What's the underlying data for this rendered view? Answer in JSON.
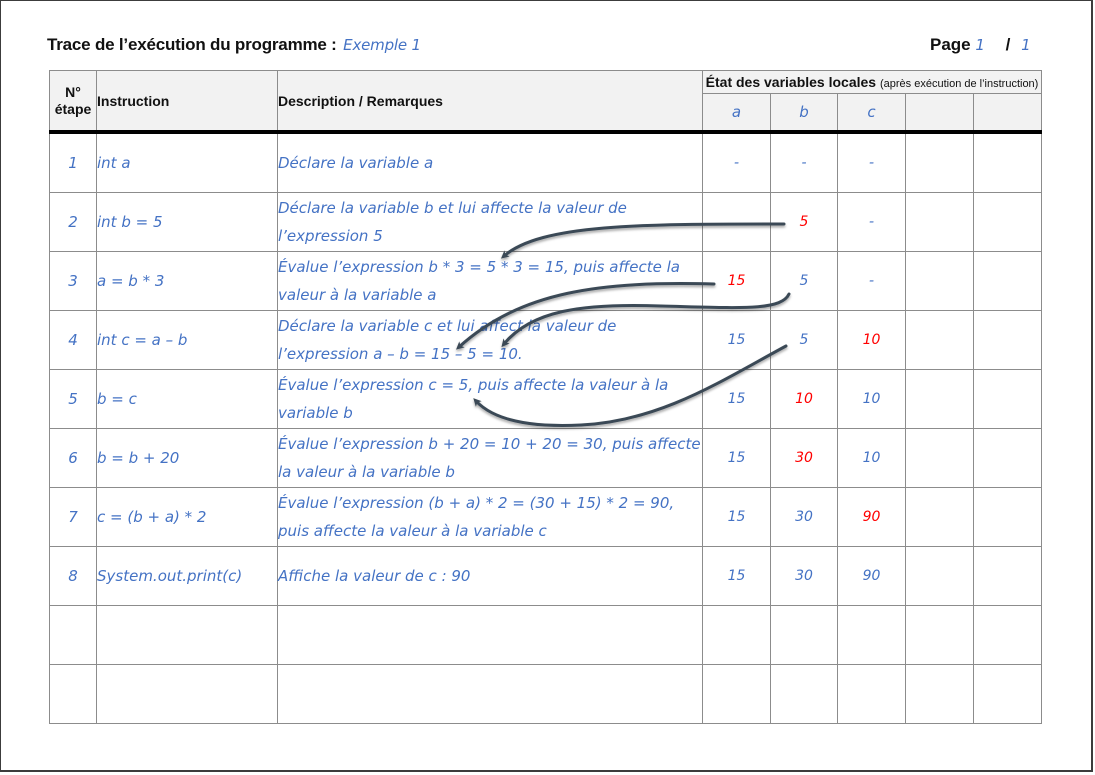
{
  "header": {
    "title": "Trace de l’exécution du programme :",
    "program_name": "Exemple 1",
    "page_label": "Page",
    "page_current": "1",
    "page_separator": "/",
    "page_total": "1"
  },
  "table": {
    "col_step": "N° étape",
    "col_step_line1": "N°",
    "col_step_line2": "étape",
    "col_instruction": "Instruction",
    "col_description": "Description / Remarques",
    "state_title": "État des variables locales",
    "state_subtitle": "(après exécution de l’instruction)",
    "variables": [
      "a",
      "b",
      "c",
      "",
      ""
    ],
    "rows": [
      {
        "step": "1",
        "instruction": "int a",
        "description": "Déclare la variable a",
        "values": [
          "-",
          "-",
          "-",
          "",
          ""
        ],
        "changed": [
          false,
          false,
          false,
          false,
          false
        ]
      },
      {
        "step": "2",
        "instruction": "int b = 5",
        "description": "Déclare la variable b et lui affecte la valeur de l’expression 5",
        "values": [
          "",
          "5",
          "-",
          "",
          ""
        ],
        "changed": [
          false,
          true,
          false,
          false,
          false
        ]
      },
      {
        "step": "3",
        "instruction": "a = b * 3",
        "description": "Évalue l’expression b * 3 = 5 * 3 = 15, puis affecte la valeur à la variable a",
        "values": [
          "15",
          "5",
          "-",
          "",
          ""
        ],
        "changed": [
          true,
          false,
          false,
          false,
          false
        ]
      },
      {
        "step": "4",
        "instruction": "int c = a – b",
        "description": "Déclare la variable c et lui affect la valeur de l’expression a – b = 15 – 5 = 10.",
        "values": [
          "15",
          "5",
          "10",
          "",
          ""
        ],
        "changed": [
          false,
          false,
          true,
          false,
          false
        ]
      },
      {
        "step": "5",
        "instruction": "b = c",
        "description": "Évalue l’expression c = 5, puis affecte la valeur à la variable b",
        "values": [
          "15",
          "10",
          "10",
          "",
          ""
        ],
        "changed": [
          false,
          true,
          false,
          false,
          false
        ]
      },
      {
        "step": "6",
        "instruction": "b = b + 20",
        "description": "Évalue l’expression b + 20 = 10 + 20 = 30, puis affecte la valeur à la variable b",
        "values": [
          "15",
          "30",
          "10",
          "",
          ""
        ],
        "changed": [
          false,
          true,
          false,
          false,
          false
        ]
      },
      {
        "step": "7",
        "instruction": "c = (b + a) * 2",
        "description": "Évalue l’expression (b + a) * 2 = (30 + 15) * 2 = 90, puis affecte la valeur à la variable c",
        "values": [
          "15",
          "30",
          "90",
          "",
          ""
        ],
        "changed": [
          false,
          false,
          true,
          false,
          false
        ]
      },
      {
        "step": "8",
        "instruction": "System.out.print(c)",
        "description": "Affiche la valeur de c : 90",
        "values": [
          "15",
          "30",
          "90",
          "",
          ""
        ],
        "changed": [
          false,
          false,
          false,
          false,
          false
        ]
      },
      {
        "step": "",
        "instruction": "",
        "description": "",
        "values": [
          "",
          "",
          "",
          "",
          ""
        ],
        "changed": [
          false,
          false,
          false,
          false,
          false
        ]
      },
      {
        "step": "",
        "instruction": "",
        "description": "",
        "values": [
          "",
          "",
          "",
          "",
          ""
        ],
        "changed": [
          false,
          false,
          false,
          false,
          false
        ]
      }
    ]
  },
  "annotations": {
    "arrows": [
      {
        "from": "row 2 / b = 5",
        "to": "row 3 description, value 5 in expression"
      },
      {
        "from": "row 3 / a = 15",
        "to": "row 4 description, value 15 in expression"
      },
      {
        "from": "row 3 / b = 5",
        "to": "row 4 description, value 5 in expression"
      },
      {
        "from": "row 4 / b = 5",
        "to": "row 5 description, value 5 in expression"
      }
    ]
  },
  "colors": {
    "handwriting": "#4472c4",
    "changed_value": "#ff0000",
    "arrow": "#3b4a56",
    "header_bg": "#f2f2f2"
  }
}
